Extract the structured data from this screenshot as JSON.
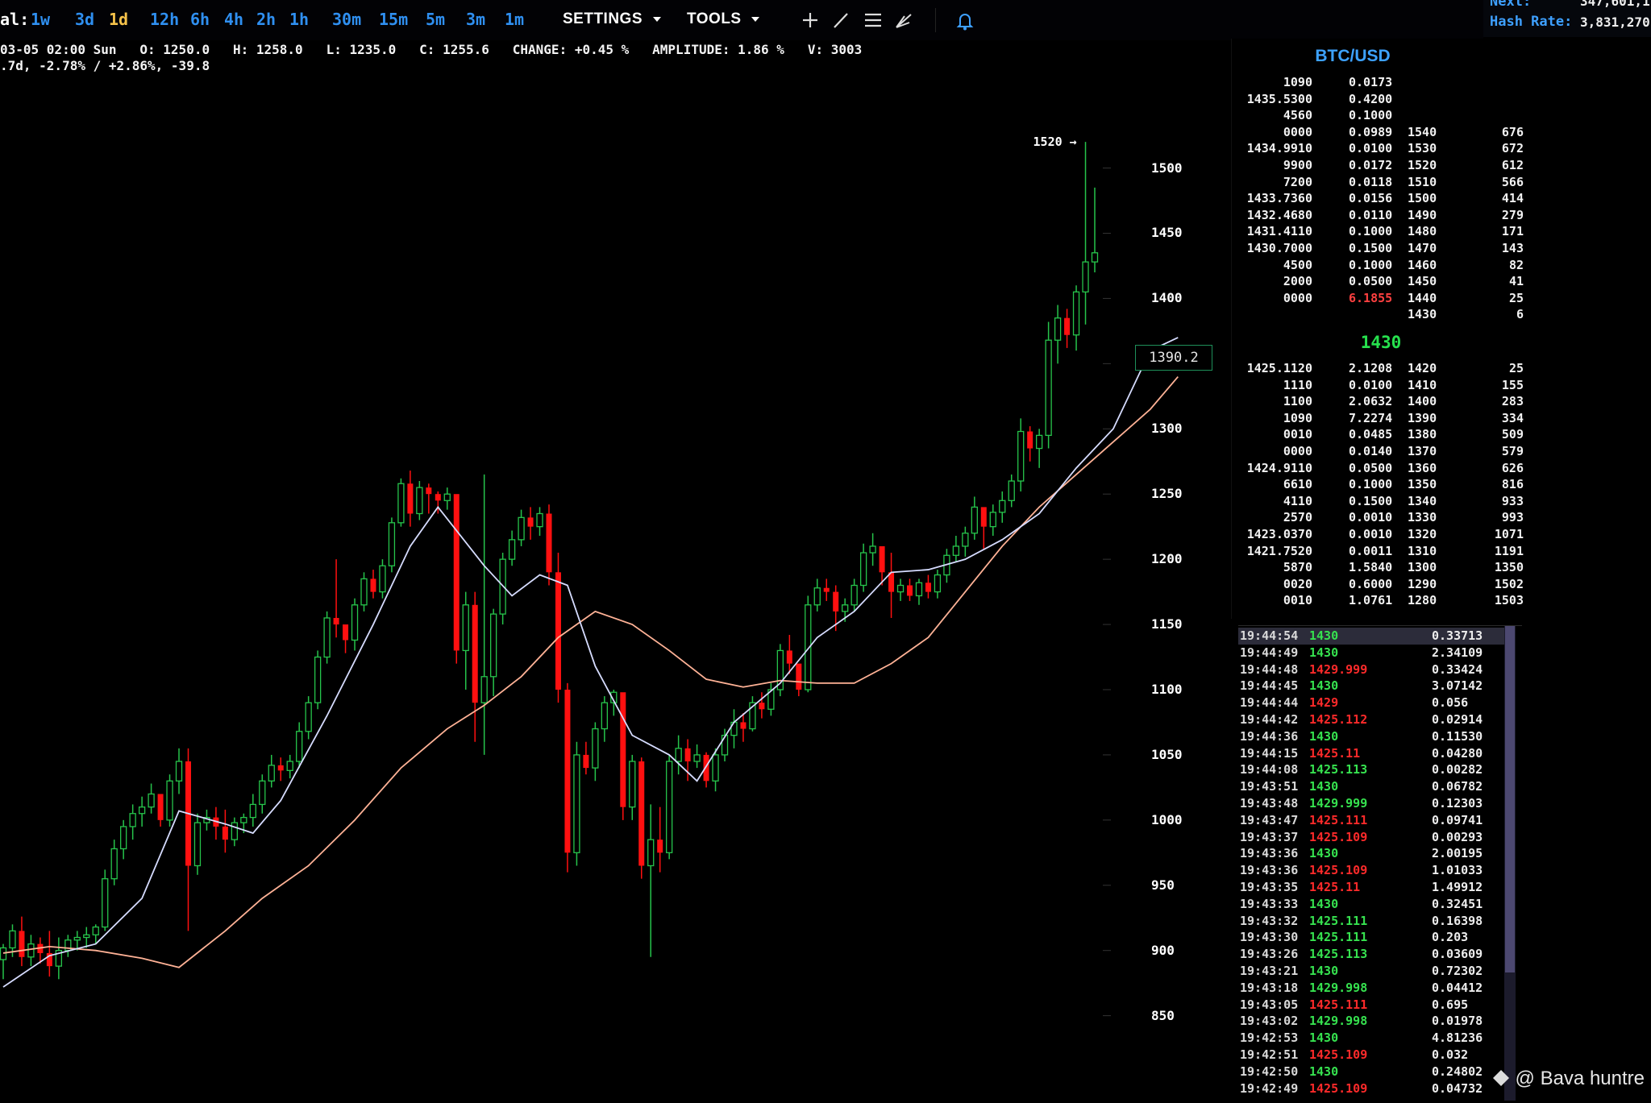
{
  "toolbar": {
    "interval_label": "al:",
    "timeframes": [
      "1w",
      "3d",
      "1d",
      "12h",
      "6h",
      "4h",
      "2h",
      "1h",
      "30m",
      "15m",
      "5m",
      "3m",
      "1m"
    ],
    "active_timeframe": "1d",
    "settings_label": "SETTINGS",
    "tools_label": "TOOLS"
  },
  "net_info": {
    "next_label": "Next:",
    "next_value": "347,601,1",
    "hash_label": "Hash Rate:",
    "hash_value": "3,831,270"
  },
  "ohlc": {
    "line1": "03-05 02:00 Sun   O: 1250.0   H: 1258.0   L: 1235.0   C: 1255.6   CHANGE: +0.45 %   AMPLITUDE: 1.86 %   V: 3003",
    "line2": ".7d, -2.78% / +2.86%, -39.8"
  },
  "chart_data": {
    "type": "candlestick",
    "yticks": [
      1500,
      1450,
      1400,
      1350,
      1300,
      1250,
      1200,
      1150,
      1100,
      1050,
      1000,
      950,
      900,
      850
    ],
    "ytick_labels": [
      "1500",
      "1450",
      "1400",
      "1350",
      "1300",
      "1250",
      "1200",
      "1150",
      "1100",
      "1050",
      "1000",
      "950",
      "900",
      "850"
    ],
    "ylim": [
      830,
      1530
    ],
    "max_label": "1520 →",
    "current_price": "1390.2",
    "candles": [
      [
        893,
        905,
        878,
        902
      ],
      [
        902,
        920,
        895,
        915
      ],
      [
        915,
        926,
        888,
        895
      ],
      [
        895,
        912,
        888,
        905
      ],
      [
        905,
        910,
        890,
        898
      ],
      [
        898,
        915,
        880,
        888
      ],
      [
        888,
        910,
        878,
        900
      ],
      [
        900,
        912,
        895,
        908
      ],
      [
        908,
        915,
        900,
        910
      ],
      [
        910,
        918,
        902,
        912
      ],
      [
        912,
        920,
        905,
        918
      ],
      [
        918,
        962,
        915,
        955
      ],
      [
        955,
        985,
        950,
        978
      ],
      [
        978,
        1000,
        970,
        995
      ],
      [
        995,
        1012,
        985,
        1005
      ],
      [
        1005,
        1018,
        995,
        1010
      ],
      [
        1010,
        1028,
        1005,
        1020
      ],
      [
        1020,
        1015,
        995,
        1000
      ],
      [
        1000,
        1035,
        995,
        1030
      ],
      [
        1030,
        1055,
        1020,
        1045
      ],
      [
        1045,
        1055,
        915,
        965
      ],
      [
        965,
        1005,
        958,
        998
      ],
      [
        998,
        1008,
        992,
        1002
      ],
      [
        1002,
        1010,
        985,
        995
      ],
      [
        995,
        1008,
        975,
        985
      ],
      [
        985,
        1002,
        980,
        998
      ],
      [
        998,
        1005,
        990,
        1002
      ],
      [
        1002,
        1020,
        995,
        1012
      ],
      [
        1012,
        1035,
        1005,
        1030
      ],
      [
        1030,
        1050,
        1025,
        1042
      ],
      [
        1042,
        1048,
        1030,
        1038
      ],
      [
        1038,
        1050,
        1032,
        1045
      ],
      [
        1045,
        1075,
        1040,
        1068
      ],
      [
        1068,
        1095,
        1062,
        1090
      ],
      [
        1090,
        1130,
        1085,
        1125
      ],
      [
        1125,
        1160,
        1120,
        1155
      ],
      [
        1155,
        1200,
        1140,
        1150
      ],
      [
        1150,
        1148,
        1128,
        1138
      ],
      [
        1138,
        1170,
        1130,
        1165
      ],
      [
        1165,
        1190,
        1160,
        1185
      ],
      [
        1185,
        1192,
        1170,
        1175
      ],
      [
        1175,
        1200,
        1170,
        1195
      ],
      [
        1195,
        1232,
        1190,
        1228
      ],
      [
        1228,
        1262,
        1225,
        1258
      ],
      [
        1258,
        1268,
        1225,
        1235
      ],
      [
        1235,
        1260,
        1230,
        1255
      ],
      [
        1255,
        1258,
        1235,
        1250
      ],
      [
        1250,
        1252,
        1235,
        1245
      ],
      [
        1245,
        1255,
        1238,
        1250
      ],
      [
        1250,
        1245,
        1120,
        1130
      ],
      [
        1130,
        1175,
        1100,
        1165
      ],
      [
        1165,
        1175,
        1060,
        1090
      ],
      [
        1090,
        1265,
        1050,
        1110
      ],
      [
        1110,
        1162,
        1095,
        1158
      ],
      [
        1158,
        1205,
        1150,
        1200
      ],
      [
        1200,
        1222,
        1195,
        1215
      ],
      [
        1215,
        1238,
        1210,
        1232
      ],
      [
        1232,
        1240,
        1215,
        1225
      ],
      [
        1225,
        1240,
        1218,
        1235
      ],
      [
        1235,
        1242,
        1180,
        1190
      ],
      [
        1190,
        1205,
        1090,
        1100
      ],
      [
        1100,
        1105,
        960,
        975
      ],
      [
        975,
        1060,
        965,
        1050
      ],
      [
        1050,
        1060,
        1035,
        1040
      ],
      [
        1040,
        1075,
        1030,
        1070
      ],
      [
        1070,
        1095,
        1060,
        1090
      ],
      [
        1090,
        1100,
        1080,
        1098
      ],
      [
        1098,
        1095,
        1000,
        1010
      ],
      [
        1010,
        1050,
        1000,
        1045
      ],
      [
        1045,
        1048,
        955,
        965
      ],
      [
        965,
        1012,
        895,
        985
      ],
      [
        985,
        1010,
        960,
        975
      ],
      [
        975,
        1050,
        970,
        1045
      ],
      [
        1045,
        1065,
        1035,
        1055
      ],
      [
        1055,
        1062,
        1030,
        1045
      ],
      [
        1045,
        1058,
        1040,
        1050
      ],
      [
        1050,
        1052,
        1025,
        1030
      ],
      [
        1030,
        1055,
        1022,
        1050
      ],
      [
        1050,
        1070,
        1045,
        1065
      ],
      [
        1065,
        1085,
        1055,
        1075
      ],
      [
        1075,
        1082,
        1060,
        1070
      ],
      [
        1070,
        1095,
        1068,
        1090
      ],
      [
        1090,
        1098,
        1078,
        1085
      ],
      [
        1085,
        1105,
        1080,
        1100
      ],
      [
        1100,
        1135,
        1095,
        1130
      ],
      [
        1130,
        1142,
        1112,
        1120
      ],
      [
        1120,
        1118,
        1095,
        1100
      ],
      [
        1100,
        1172,
        1098,
        1165
      ],
      [
        1165,
        1185,
        1160,
        1178
      ],
      [
        1178,
        1185,
        1168,
        1175
      ],
      [
        1175,
        1180,
        1145,
        1160
      ],
      [
        1160,
        1170,
        1152,
        1165
      ],
      [
        1165,
        1185,
        1160,
        1180
      ],
      [
        1180,
        1212,
        1175,
        1205
      ],
      [
        1205,
        1220,
        1195,
        1210
      ],
      [
        1210,
        1208,
        1180,
        1190
      ],
      [
        1190,
        1205,
        1155,
        1175
      ],
      [
        1175,
        1185,
        1168,
        1180
      ],
      [
        1180,
        1185,
        1168,
        1172
      ],
      [
        1172,
        1185,
        1165,
        1182
      ],
      [
        1182,
        1188,
        1170,
        1175
      ],
      [
        1175,
        1192,
        1170,
        1188
      ],
      [
        1188,
        1208,
        1182,
        1203
      ],
      [
        1203,
        1218,
        1198,
        1210
      ],
      [
        1210,
        1225,
        1202,
        1220
      ],
      [
        1220,
        1248,
        1215,
        1240
      ],
      [
        1240,
        1235,
        1208,
        1225
      ],
      [
        1225,
        1242,
        1218,
        1236
      ],
      [
        1236,
        1252,
        1228,
        1245
      ],
      [
        1245,
        1265,
        1240,
        1260
      ],
      [
        1260,
        1308,
        1252,
        1298
      ],
      [
        1298,
        1302,
        1275,
        1285
      ],
      [
        1285,
        1300,
        1270,
        1295
      ],
      [
        1295,
        1382,
        1285,
        1368
      ],
      [
        1368,
        1395,
        1350,
        1385
      ],
      [
        1385,
        1392,
        1362,
        1372
      ],
      [
        1372,
        1410,
        1360,
        1405
      ],
      [
        1405,
        1520,
        1380,
        1428
      ],
      [
        1428,
        1485,
        1420,
        1435
      ]
    ],
    "ma_fast": [
      [
        0,
        872
      ],
      [
        5,
        896
      ],
      [
        10,
        905
      ],
      [
        15,
        940
      ],
      [
        19,
        1007
      ],
      [
        24,
        997
      ],
      [
        27,
        990
      ],
      [
        30,
        1015
      ],
      [
        35,
        1080
      ],
      [
        40,
        1150
      ],
      [
        44,
        1210
      ],
      [
        47,
        1240
      ],
      [
        52,
        1195
      ],
      [
        55,
        1172
      ],
      [
        58,
        1188
      ],
      [
        61,
        1180
      ],
      [
        64,
        1118
      ],
      [
        68,
        1065
      ],
      [
        72,
        1050
      ],
      [
        75,
        1030
      ],
      [
        79,
        1075
      ],
      [
        84,
        1105
      ],
      [
        88,
        1140
      ],
      [
        92,
        1160
      ],
      [
        96,
        1190
      ],
      [
        100,
        1192
      ],
      [
        104,
        1200
      ],
      [
        108,
        1215
      ],
      [
        112,
        1235
      ],
      [
        116,
        1270
      ],
      [
        120,
        1300
      ],
      [
        124,
        1360
      ],
      [
        127,
        1370
      ]
    ],
    "ma_slow": [
      [
        0,
        898
      ],
      [
        5,
        903
      ],
      [
        10,
        900
      ],
      [
        15,
        894
      ],
      [
        19,
        887
      ],
      [
        24,
        915
      ],
      [
        28,
        940
      ],
      [
        33,
        965
      ],
      [
        38,
        1000
      ],
      [
        43,
        1040
      ],
      [
        48,
        1070
      ],
      [
        52,
        1088
      ],
      [
        56,
        1110
      ],
      [
        60,
        1140
      ],
      [
        64,
        1160
      ],
      [
        68,
        1150
      ],
      [
        72,
        1130
      ],
      [
        76,
        1108
      ],
      [
        80,
        1102
      ],
      [
        84,
        1107
      ],
      [
        88,
        1105
      ],
      [
        92,
        1105
      ],
      [
        96,
        1120
      ],
      [
        100,
        1140
      ],
      [
        104,
        1175
      ],
      [
        108,
        1210
      ],
      [
        112,
        1240
      ],
      [
        116,
        1265
      ],
      [
        120,
        1290
      ],
      [
        124,
        1315
      ],
      [
        127,
        1340
      ]
    ],
    "colors": {
      "up": "#26c44b",
      "down": "#ff1010",
      "ma_fast": "#d6dcff",
      "ma_slow": "#ffb296"
    }
  },
  "orderbook": {
    "title": "BTC/USD",
    "asks": [
      {
        "price": "1090",
        "amount": "0.0173",
        "level": "",
        "total": ""
      },
      {
        "price": "1435.5300",
        "amount": "0.4200",
        "level": "",
        "total": ""
      },
      {
        "price": "4560",
        "amount": "0.1000",
        "level": "",
        "total": ""
      },
      {
        "price": "0000",
        "amount": "0.0989",
        "level": "1540",
        "total": "676"
      },
      {
        "price": "1434.9910",
        "amount": "0.0100",
        "level": "1530",
        "total": "672"
      },
      {
        "price": "9900",
        "amount": "0.0172",
        "level": "1520",
        "total": "612"
      },
      {
        "price": "7200",
        "amount": "0.0118",
        "level": "1510",
        "total": "566"
      },
      {
        "price": "1433.7360",
        "amount": "0.0156",
        "level": "1500",
        "total": "414"
      },
      {
        "price": "1432.4680",
        "amount": "0.0110",
        "level": "1490",
        "total": "279"
      },
      {
        "price": "1431.4110",
        "amount": "0.1000",
        "level": "1480",
        "total": "171"
      },
      {
        "price": "1430.7000",
        "amount": "0.1500",
        "level": "1470",
        "total": "143"
      },
      {
        "price": "4500",
        "amount": "0.1000",
        "level": "1460",
        "total": "82"
      },
      {
        "price": "2000",
        "amount": "0.0500",
        "level": "1450",
        "total": "41"
      },
      {
        "price": "0000",
        "amount": "6.1855",
        "level": "1440",
        "total": "25"
      },
      {
        "price": "",
        "amount": "",
        "level": "1430",
        "total": "6"
      }
    ],
    "mid_price": "1430",
    "bids": [
      {
        "price": "1425.1120",
        "amount": "2.1208",
        "level": "1420",
        "total": "25"
      },
      {
        "price": "1110",
        "amount": "0.0100",
        "level": "1410",
        "total": "155"
      },
      {
        "price": "1100",
        "amount": "2.0632",
        "level": "1400",
        "total": "283"
      },
      {
        "price": "1090",
        "amount": "7.2274",
        "level": "1390",
        "total": "334"
      },
      {
        "price": "0010",
        "amount": "0.0485",
        "level": "1380",
        "total": "509"
      },
      {
        "price": "0000",
        "amount": "0.0140",
        "level": "1370",
        "total": "579"
      },
      {
        "price": "1424.9110",
        "amount": "0.0500",
        "level": "1360",
        "total": "626"
      },
      {
        "price": "6610",
        "amount": "0.1000",
        "level": "1350",
        "total": "816"
      },
      {
        "price": "4110",
        "amount": "0.1500",
        "level": "1340",
        "total": "933"
      },
      {
        "price": "2570",
        "amount": "0.0010",
        "level": "1330",
        "total": "993"
      },
      {
        "price": "1423.0370",
        "amount": "0.0010",
        "level": "1320",
        "total": "1071"
      },
      {
        "price": "1421.7520",
        "amount": "0.0011",
        "level": "1310",
        "total": "1191"
      },
      {
        "price": "5870",
        "amount": "1.5840",
        "level": "1300",
        "total": "1350"
      },
      {
        "price": "0020",
        "amount": "0.6000",
        "level": "1290",
        "total": "1502"
      },
      {
        "price": "0010",
        "amount": "1.0761",
        "level": "1280",
        "total": "1503"
      }
    ]
  },
  "trades": [
    {
      "time": "19:44:54",
      "price": "1430",
      "side": "buy",
      "amount": "0.33713"
    },
    {
      "time": "19:44:49",
      "price": "1430",
      "side": "buy",
      "amount": "2.34109"
    },
    {
      "time": "19:44:48",
      "price": "1429.999",
      "side": "sell",
      "amount": "0.33424"
    },
    {
      "time": "19:44:45",
      "price": "1430",
      "side": "buy",
      "amount": "3.07142"
    },
    {
      "time": "19:44:44",
      "price": "1429",
      "side": "sell",
      "amount": "0.056"
    },
    {
      "time": "19:44:42",
      "price": "1425.112",
      "side": "sell",
      "amount": "0.02914"
    },
    {
      "time": "19:44:36",
      "price": "1430",
      "side": "buy",
      "amount": "0.11530"
    },
    {
      "time": "19:44:15",
      "price": "1425.11",
      "side": "sell",
      "amount": "0.04280"
    },
    {
      "time": "19:44:08",
      "price": "1425.113",
      "side": "buy",
      "amount": "0.00282"
    },
    {
      "time": "19:43:51",
      "price": "1430",
      "side": "buy",
      "amount": "0.06782"
    },
    {
      "time": "19:43:48",
      "price": "1429.999",
      "side": "buy",
      "amount": "0.12303"
    },
    {
      "time": "19:43:47",
      "price": "1425.111",
      "side": "sell",
      "amount": "0.09741"
    },
    {
      "time": "19:43:37",
      "price": "1425.109",
      "side": "sell",
      "amount": "0.00293"
    },
    {
      "time": "19:43:36",
      "price": "1430",
      "side": "buy",
      "amount": "2.00195"
    },
    {
      "time": "19:43:36",
      "price": "1425.109",
      "side": "sell",
      "amount": "1.01033"
    },
    {
      "time": "19:43:35",
      "price": "1425.11",
      "side": "sell",
      "amount": "1.49912"
    },
    {
      "time": "19:43:33",
      "price": "1430",
      "side": "buy",
      "amount": "0.32451"
    },
    {
      "time": "19:43:32",
      "price": "1425.111",
      "side": "buy",
      "amount": "0.16398"
    },
    {
      "time": "19:43:30",
      "price": "1425.111",
      "side": "buy",
      "amount": "0.203"
    },
    {
      "time": "19:43:26",
      "price": "1425.113",
      "side": "buy",
      "amount": "0.03609"
    },
    {
      "time": "19:43:21",
      "price": "1430",
      "side": "buy",
      "amount": "0.72302"
    },
    {
      "time": "19:43:18",
      "price": "1429.998",
      "side": "buy",
      "amount": "0.04412"
    },
    {
      "time": "19:43:05",
      "price": "1425.111",
      "side": "sell",
      "amount": "0.695"
    },
    {
      "time": "19:43:02",
      "price": "1429.998",
      "side": "buy",
      "amount": "0.01978"
    },
    {
      "time": "19:42:53",
      "price": "1430",
      "side": "buy",
      "amount": "4.81236"
    },
    {
      "time": "19:42:51",
      "price": "1425.109",
      "side": "sell",
      "amount": "0.032"
    },
    {
      "time": "19:42:50",
      "price": "1430",
      "side": "buy",
      "amount": "0.24802"
    },
    {
      "time": "19:42:49",
      "price": "1425.109",
      "side": "sell",
      "amount": "0.04732"
    }
  ],
  "watermark": "@ Bava huntre",
  "colors": {
    "buy": "#36e24f",
    "sell": "#ff2a2a",
    "timeframe": "#2f8ff0",
    "timeframe_active": "#f6c24a"
  }
}
